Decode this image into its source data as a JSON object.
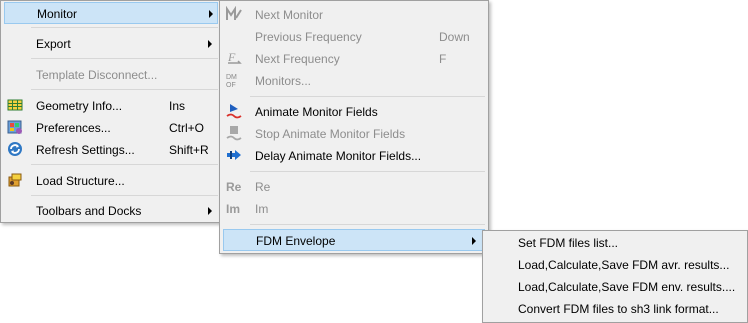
{
  "main_menu": {
    "items": [
      {
        "label": "Monitor"
      },
      {
        "label": "Export"
      },
      {
        "label": "Template Disconnect..."
      },
      {
        "label": "Geometry Info...",
        "shortcut": "Ins"
      },
      {
        "label": "Preferences...",
        "shortcut": "Ctrl+O"
      },
      {
        "label": "Refresh Settings...",
        "shortcut": "Shift+R"
      },
      {
        "label": "Load Structure..."
      },
      {
        "label": "Toolbars and Docks"
      }
    ]
  },
  "monitor_menu": {
    "items": [
      {
        "label": "Next  Monitor"
      },
      {
        "label": "Previous Frequency",
        "shortcut": "Down"
      },
      {
        "label": "Next Frequency",
        "shortcut": "F"
      },
      {
        "label": "Monitors..."
      },
      {
        "label": "Animate Monitor Fields"
      },
      {
        "label": "Stop Animate Monitor Fields"
      },
      {
        "label": "Delay Animate Monitor Fields..."
      },
      {
        "label": "Re"
      },
      {
        "label": "Im"
      },
      {
        "label": "FDM Envelope"
      }
    ]
  },
  "fdm_menu": {
    "items": [
      {
        "label": "Set FDM files list..."
      },
      {
        "label": "Load,Calculate,Save FDM avr. results..."
      },
      {
        "label": "Load,Calculate,Save FDM env. results...."
      },
      {
        "label": "Convert FDM files to sh3 link format..."
      }
    ]
  },
  "colors": {
    "menu_bg": "#f0f0f0",
    "highlight": "#cce4f7",
    "highlight_border": "#99c9ef",
    "disabled_text": "#8d8d8d"
  }
}
